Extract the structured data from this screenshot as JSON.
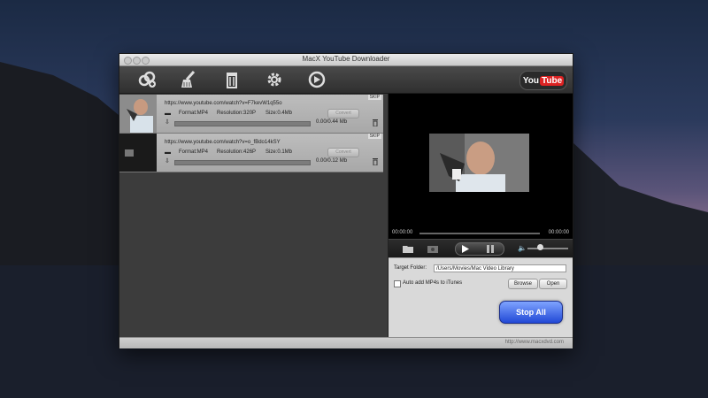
{
  "window": {
    "title": "MacX YouTube Downloader"
  },
  "toolbar": {
    "icons": [
      "add-link-icon",
      "clean-brush-icon",
      "trash-icon",
      "gear-icon",
      "update-icon"
    ],
    "youtube_left": "You",
    "youtube_right": "Tube"
  },
  "downloads": [
    {
      "url": "https://www.youtube.com/watch?v=F7kevW1q55o",
      "format": "Format:MP4",
      "resolution": "Resolution:320P",
      "size": "Size:0.4Mb",
      "convert_label": "Convert",
      "progress_text": "0.00/0.44 Mb",
      "progress": 0.0,
      "skip_label": "SKIP"
    },
    {
      "url": "https://www.youtube.com/watch?v=o_fBdo14kSY",
      "format": "Format:MP4",
      "resolution": "Resolution:426P",
      "size": "Size:0.1Mb",
      "convert_label": "Convert",
      "progress_text": "0.00/0.12 Mb",
      "progress": 0.0,
      "skip_label": "SKIP"
    }
  ],
  "player": {
    "time_start": "00:00:00",
    "time_end": "00:00:00"
  },
  "settings": {
    "target_folder_label": "Target Folder:",
    "target_folder_value": "/Users/Movies/Mac Video Library",
    "itunes_label": "Auto add MP4s to iTunes",
    "browse_label": "Browse",
    "open_label": "Open",
    "stop_all_label": "Stop All"
  },
  "status": {
    "url": "http://www.macxdvd.com"
  }
}
